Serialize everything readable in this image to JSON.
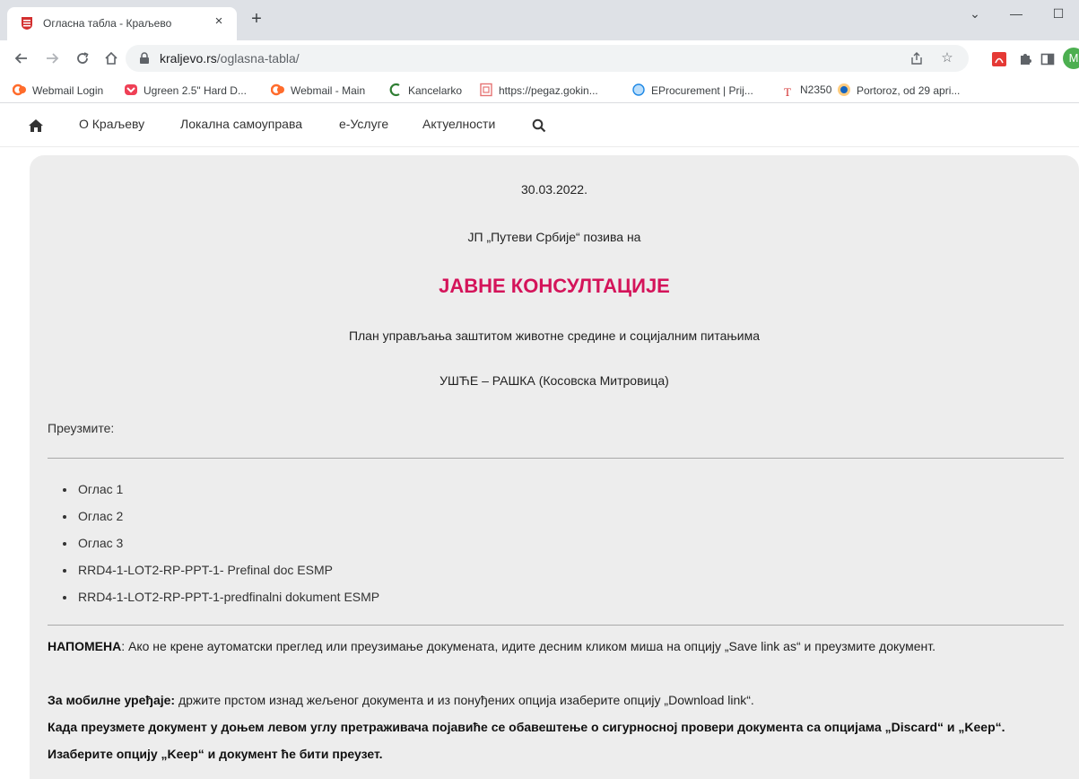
{
  "browser": {
    "tab": {
      "title": "Огласна табла - Краљево",
      "close": "×"
    },
    "new_tab": "+",
    "window_controls": {
      "minimize": "—",
      "maximize": "☐",
      "dropdown": "⌄"
    },
    "url_host": "kraljevo.rs",
    "url_path": "/oglasna-tabla/",
    "profile_initial": "M"
  },
  "bookmarks": [
    {
      "label": "Webmail Login",
      "icon": "cpanel-icon",
      "color": "#ff6c2c"
    },
    {
      "label": "Ugreen 2.5\" Hard D...",
      "icon": "pocket-icon",
      "color": "#ef4056"
    },
    {
      "label": "Webmail - Main",
      "icon": "cpanel-icon",
      "color": "#ff6c2c"
    },
    {
      "label": "Kancelarko",
      "icon": "kancelarko-icon",
      "color": "#2e7d32"
    },
    {
      "label": "https://pegaz.gokin...",
      "icon": "page-icon",
      "color": "#e57373"
    },
    {
      "label": "EProcurement | Prij...",
      "icon": "eprocurement-icon",
      "color": "#1e88e5"
    },
    {
      "label": "N2350",
      "icon": "text-icon",
      "color": "#d32f2f"
    },
    {
      "label": "Portoroz, od 29 apri...",
      "icon": "booking-icon",
      "color": "#ef6c00"
    }
  ],
  "site_nav": {
    "items": [
      "О Краљеву",
      "Локална самоуправа",
      "е-Услуге",
      "Актуелности"
    ]
  },
  "content": {
    "date": "30.03.2022.",
    "intro": "ЈП „Путеви Србије“ позива на",
    "headline": "ЈАВНЕ КОНСУЛТАЦИЈЕ",
    "subtitle": "План управљања заштитом животне средине и социјалним питањима",
    "route": "УШЋЕ – РАШКА (Косовска Митровица)",
    "download_label": "Преузмите:",
    "links": [
      "Оглас 1",
      "Оглас 2",
      "Оглас 3",
      "RRD4-1-LOT2-RP-PPT-1- Prefinal doc ESMP",
      "RRD4-1-LOT2-RP-PPT-1-predfinalni dokument ESMP"
    ],
    "note_label": "НАПОМЕНА",
    "note_text": ": Ако не крене аутоматски преглед или преузимање докумената, идите десним кликом миша на опцију „Save link as“  и преузмите документ.",
    "mobile_label": "За мобилне уређаје:",
    "mobile_text": " држите прстом изнад жељеног документа и из понуђених опција изаберите опцију „Download link“.",
    "warning": "Када преузмете документ у доњем левом углу претраживача појавиће се обавештење о сигурносној провери документа са опцијама „Discard“ и „Keep“. Изаберите опцију „Keep“ и документ ће бити преузет."
  },
  "colors": {
    "accent": "#d4145a",
    "panel": "#ededed",
    "tabstrip": "#dee1e6"
  }
}
